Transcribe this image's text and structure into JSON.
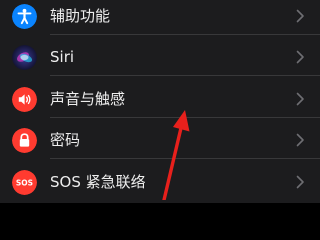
{
  "settings": {
    "items": [
      {
        "label": "辅助功能",
        "icon": "accessibility-icon",
        "color": "#0a84ff"
      },
      {
        "label": "Siri",
        "icon": "siri-icon",
        "color": "#3a2a8c"
      },
      {
        "label": "声音与触感",
        "icon": "speaker-icon",
        "color": "#ff3b30"
      },
      {
        "label": "密码",
        "icon": "lock-icon",
        "color": "#ff3b30"
      },
      {
        "label": "SOS 紧急联络",
        "icon": "sos-icon",
        "color": "#ff3b30",
        "icon_text": "SOS"
      }
    ]
  },
  "annotation": {
    "arrow_color": "#e8201c",
    "points_to": "声音与触感"
  },
  "colors": {
    "background": "#000000",
    "cell_background": "#1c1c1e",
    "separator": "#38383a",
    "chevron": "#6e6e72",
    "text": "#ededed"
  }
}
